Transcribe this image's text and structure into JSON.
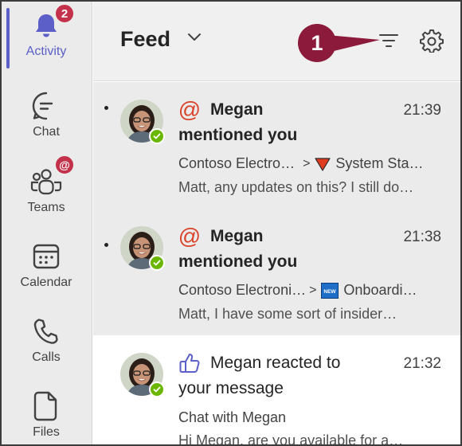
{
  "rail": {
    "items": [
      {
        "label": "Activity",
        "icon": "bell-icon",
        "badge": "2",
        "active": true
      },
      {
        "label": "Chat",
        "icon": "chat-icon"
      },
      {
        "label": "Teams",
        "icon": "teams-icon",
        "badge": "@"
      },
      {
        "label": "Calendar",
        "icon": "calendar-icon"
      },
      {
        "label": "Calls",
        "icon": "phone-icon"
      },
      {
        "label": "Files",
        "icon": "file-icon"
      }
    ]
  },
  "header": {
    "title": "Feed",
    "callout": "1"
  },
  "feed": [
    {
      "type": "mention",
      "line1": "Megan",
      "line2": "mentioned you",
      "time": "21:39",
      "source": "Contoso Electro…",
      "channel": "System Sta…",
      "channel_icon": "red-triangle-icon",
      "preview": "Matt, any updates on this? I still do…",
      "unread": true
    },
    {
      "type": "mention",
      "line1": "Megan",
      "line2": "mentioned you",
      "time": "21:38",
      "source": "Contoso Electroni…",
      "channel": "Onboardi…",
      "channel_icon": "new-badge-icon",
      "channel_icon_text": "NEW",
      "preview": "Matt, I have some sort of insider…",
      "unread": true
    },
    {
      "type": "reaction",
      "line1": "Megan reacted to",
      "line2": "your message",
      "time": "21:32",
      "source": "Chat with Megan",
      "preview": "Hi Megan, are you available for a…",
      "unread": false
    }
  ],
  "colors": {
    "accent": "#5b5fc7",
    "badge": "#c4314b",
    "mention": "#d9442a",
    "presence": "#6bb700",
    "callout": "#8b1a3b"
  }
}
